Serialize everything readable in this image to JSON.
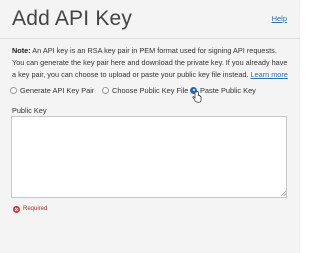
{
  "dialog": {
    "title": "Add API Key",
    "help_label": "Help"
  },
  "note": {
    "label": "Note:",
    "text": "An API key is an RSA key pair in PEM format used for signing API requests. You can generate the key pair here and download the private key. If you already have a key pair, you can choose to upload or paste your public key file instead.",
    "link": "Learn more"
  },
  "key_options": [
    {
      "label": "Generate API Key Pair",
      "selected": false
    },
    {
      "label": "Choose Public Key File",
      "selected": false
    },
    {
      "label": "Paste Public Key",
      "selected": true
    }
  ],
  "public_key": {
    "label": "Public Key",
    "value": "",
    "required_label": "Required"
  },
  "colors": {
    "accent": "#2a6aa8",
    "link": "#2f6fb2",
    "error": "#c23b3b"
  }
}
